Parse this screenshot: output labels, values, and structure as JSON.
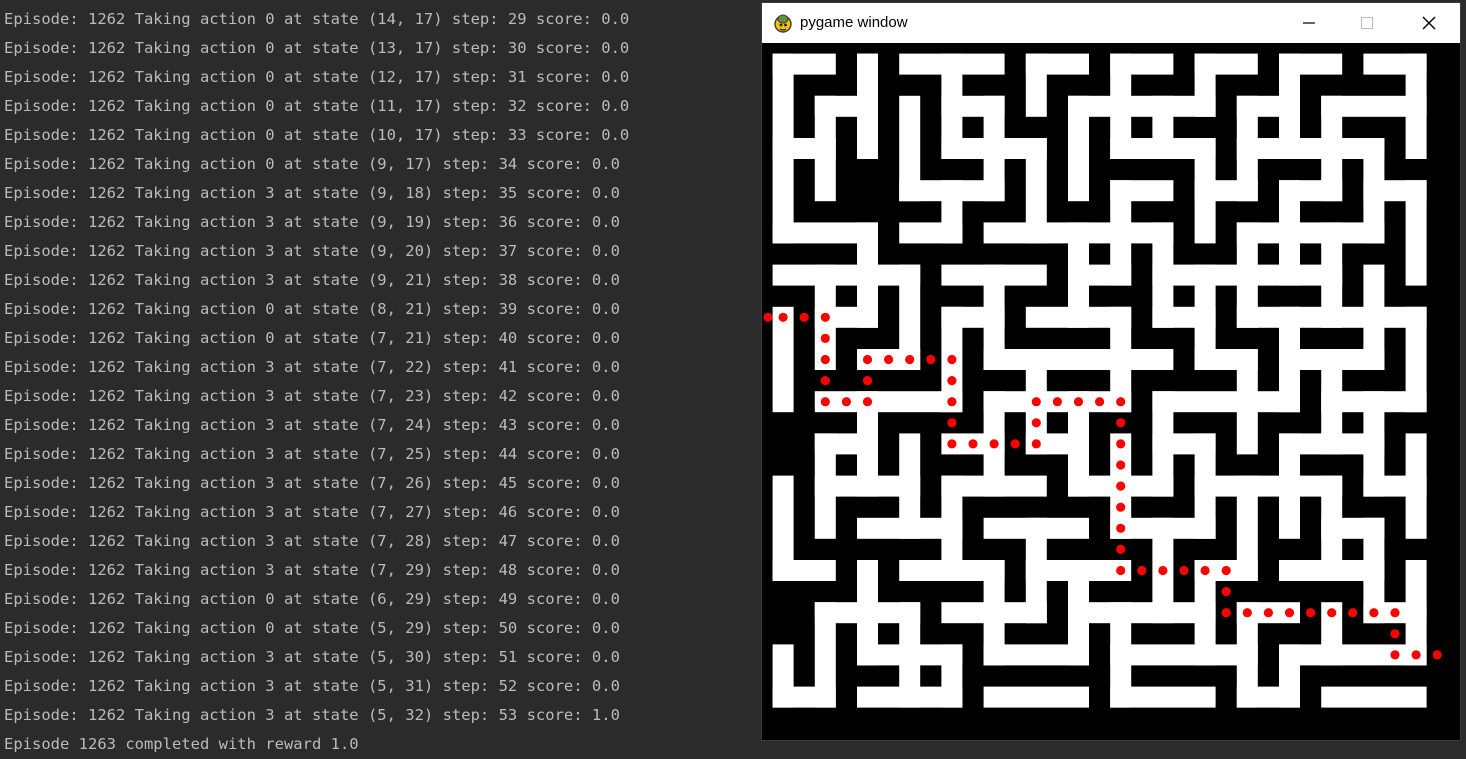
{
  "console": {
    "lines": [
      "Episode: 1262 Taking action 0 at state (14, 17) step: 29 score: 0.0",
      "Episode: 1262 Taking action 0 at state (13, 17) step: 30 score: 0.0",
      "Episode: 1262 Taking action 0 at state (12, 17) step: 31 score: 0.0",
      "Episode: 1262 Taking action 0 at state (11, 17) step: 32 score: 0.0",
      "Episode: 1262 Taking action 0 at state (10, 17) step: 33 score: 0.0",
      "Episode: 1262 Taking action 0 at state (9, 17) step: 34 score: 0.0",
      "Episode: 1262 Taking action 3 at state (9, 18) step: 35 score: 0.0",
      "Episode: 1262 Taking action 3 at state (9, 19) step: 36 score: 0.0",
      "Episode: 1262 Taking action 3 at state (9, 20) step: 37 score: 0.0",
      "Episode: 1262 Taking action 3 at state (9, 21) step: 38 score: 0.0",
      "Episode: 1262 Taking action 0 at state (8, 21) step: 39 score: 0.0",
      "Episode: 1262 Taking action 0 at state (7, 21) step: 40 score: 0.0",
      "Episode: 1262 Taking action 3 at state (7, 22) step: 41 score: 0.0",
      "Episode: 1262 Taking action 3 at state (7, 23) step: 42 score: 0.0",
      "Episode: 1262 Taking action 3 at state (7, 24) step: 43 score: 0.0",
      "Episode: 1262 Taking action 3 at state (7, 25) step: 44 score: 0.0",
      "Episode: 1262 Taking action 3 at state (7, 26) step: 45 score: 0.0",
      "Episode: 1262 Taking action 3 at state (7, 27) step: 46 score: 0.0",
      "Episode: 1262 Taking action 3 at state (7, 28) step: 47 score: 0.0",
      "Episode: 1262 Taking action 3 at state (7, 29) step: 48 score: 0.0",
      "Episode: 1262 Taking action 0 at state (6, 29) step: 49 score: 0.0",
      "Episode: 1262 Taking action 0 at state (5, 29) step: 50 score: 0.0",
      "Episode: 1262 Taking action 3 at state (5, 30) step: 51 score: 0.0",
      "Episode: 1262 Taking action 3 at state (5, 31) step: 52 score: 0.0",
      "Episode: 1262 Taking action 3 at state (5, 32) step: 53 score: 1.0",
      "Episode 1263 completed with reward 1.0"
    ]
  },
  "window": {
    "title": "pygame window",
    "app_icon": "pygame-snake-icon",
    "controls": [
      "minimize-icon",
      "maximize-icon",
      "close-icon"
    ]
  },
  "maze": {
    "wall_color": "#000000",
    "path_color": "#ffffff",
    "trail_color": "#ff0000"
  }
}
